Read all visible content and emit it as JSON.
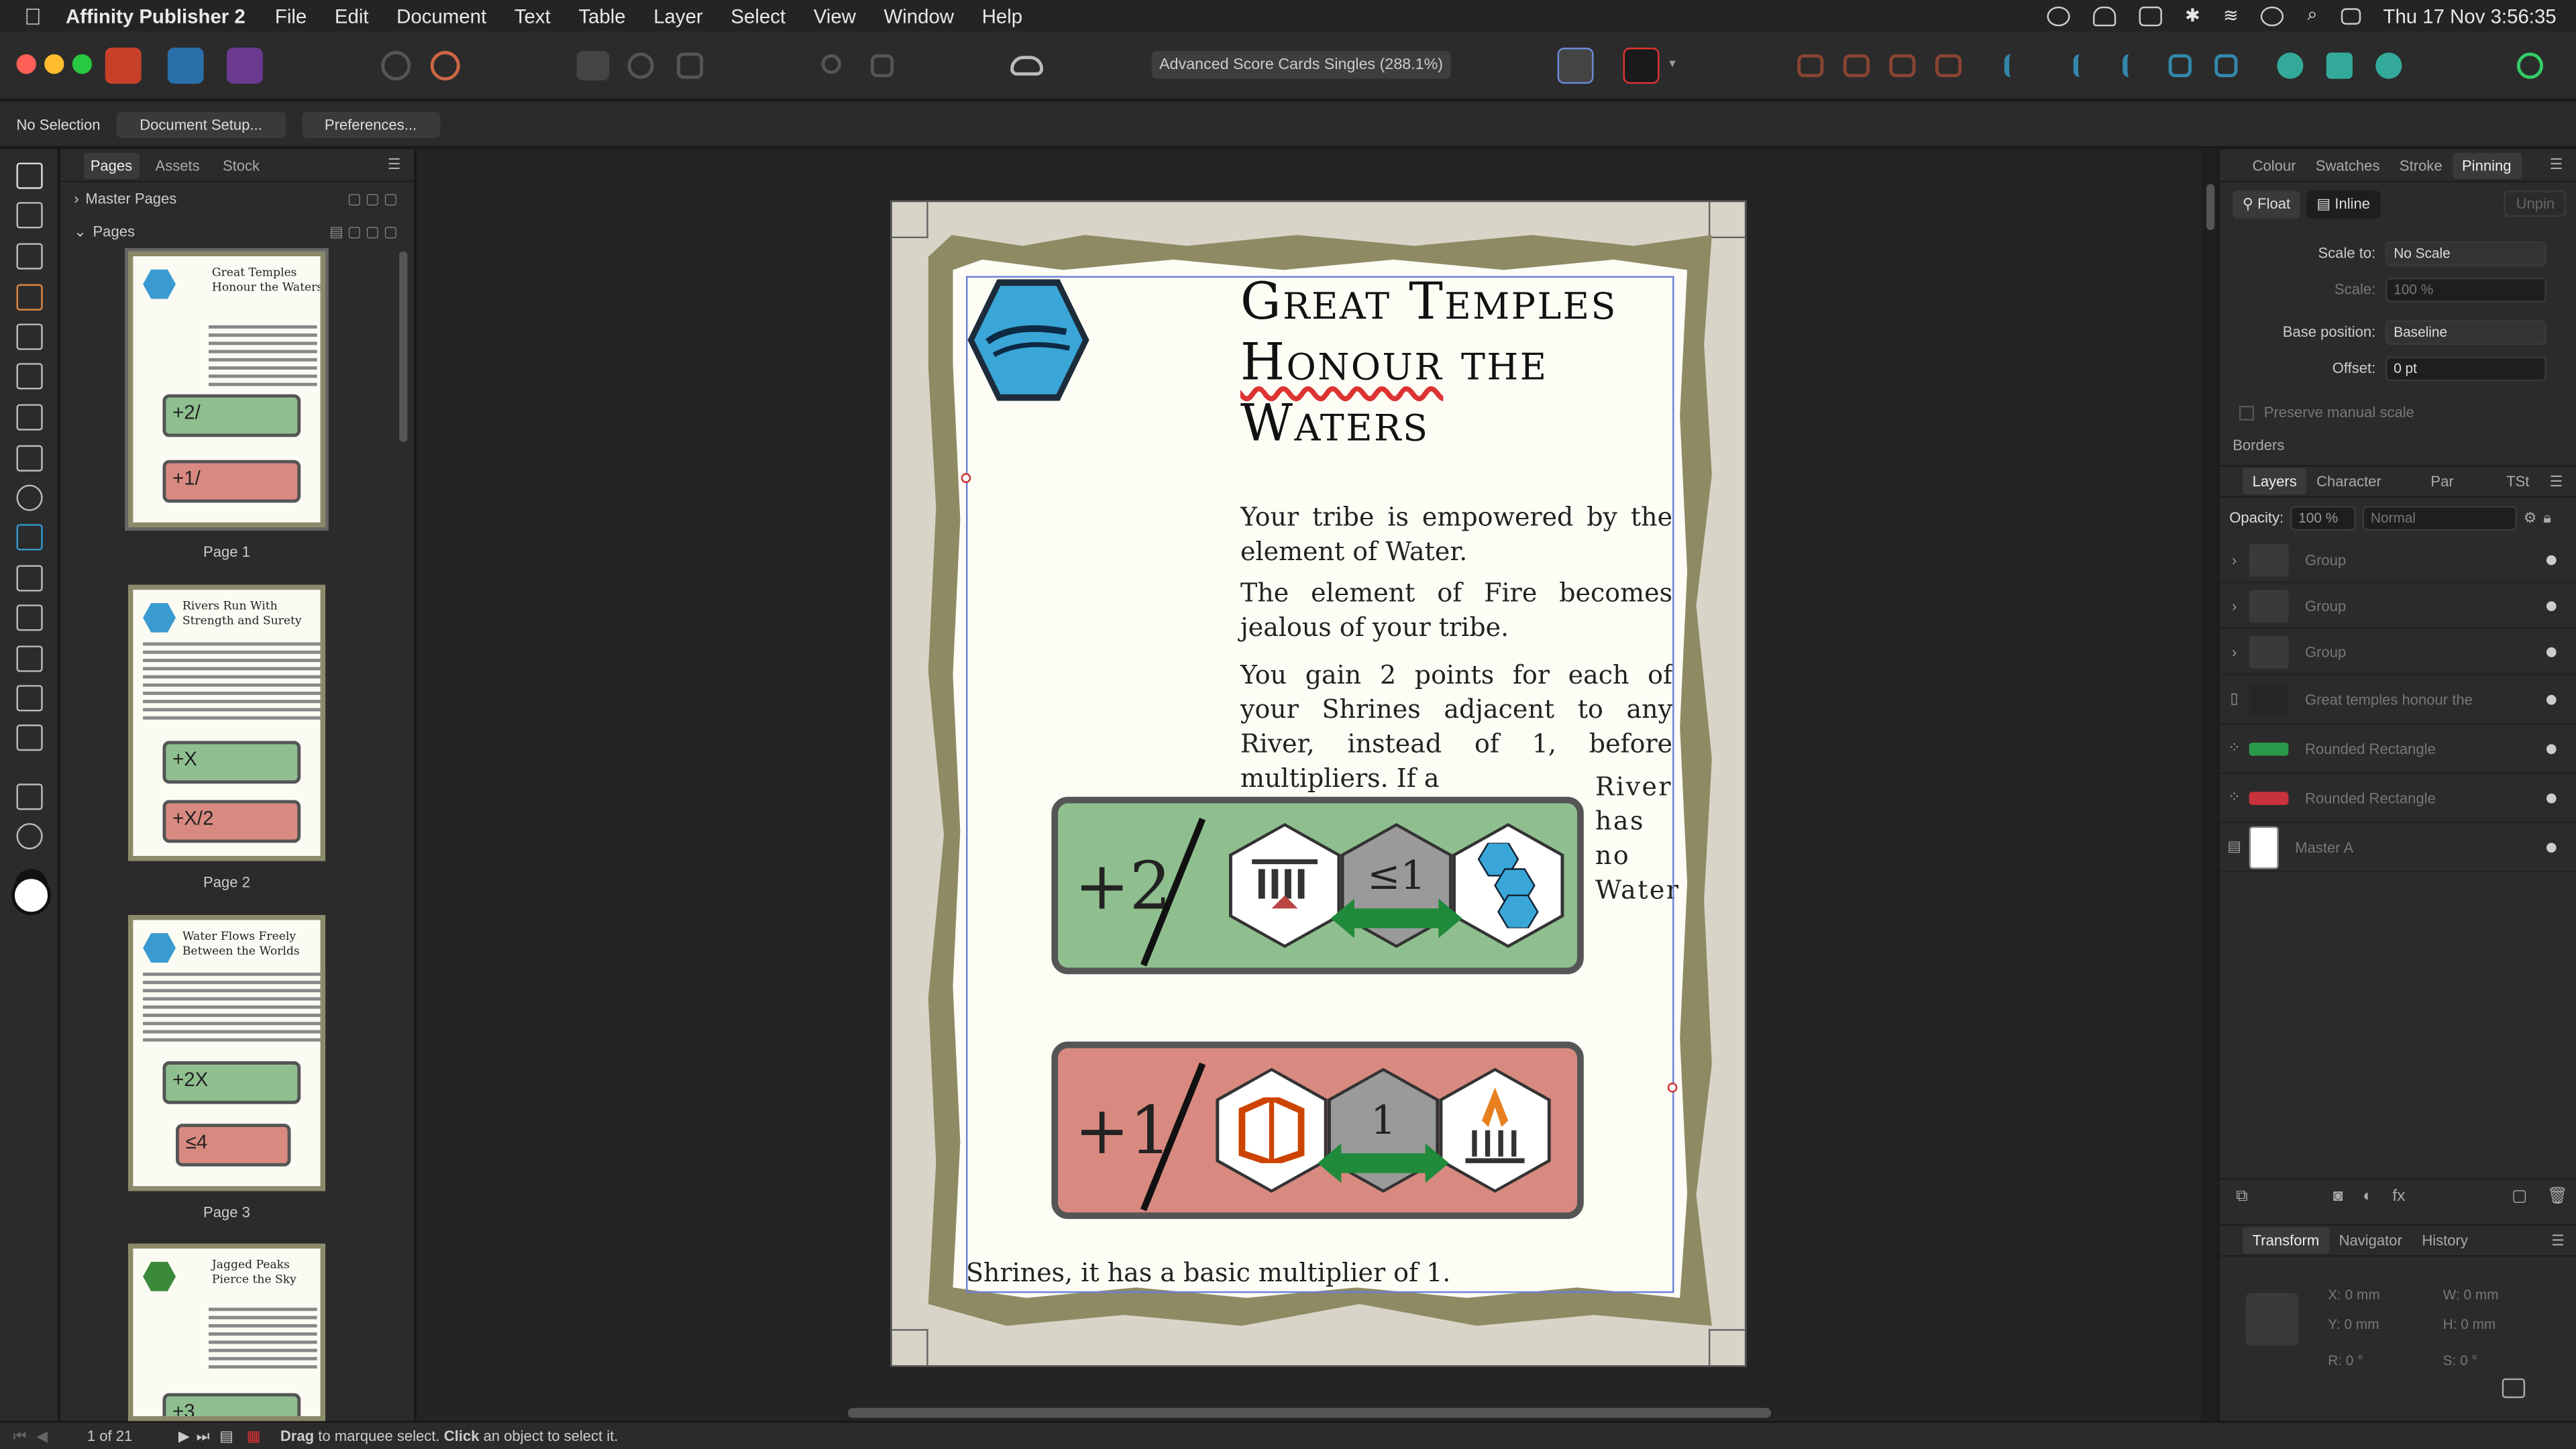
{
  "menubar": {
    "app_name": "Affinity Publisher 2",
    "items": [
      "File",
      "Edit",
      "Document",
      "Text",
      "Table",
      "Layer",
      "Select",
      "View",
      "Window",
      "Help"
    ],
    "clock": "Thu 17 Nov  3:56:35"
  },
  "toolbar": {
    "document_title": "Advanced Score Cards Singles (288.1%)"
  },
  "context_bar": {
    "selection": "No Selection",
    "document_setup": "Document Setup...",
    "preferences": "Preferences..."
  },
  "pages_panel": {
    "tabs": [
      "Pages",
      "Assets",
      "Stock"
    ],
    "master_pages": "Master Pages",
    "pages": "Pages",
    "thumbnails": [
      {
        "title": "Great Temples Honour the Waters",
        "label": "Page 1",
        "top": "+2/",
        "bottom": "+1/"
      },
      {
        "title": "Rivers Run With Strength and Surety",
        "label": "Page 2",
        "top": "+X",
        "bottom": "+X/2"
      },
      {
        "title": "Water Flows Freely Between the Worlds",
        "label": "Page 3",
        "top": "+2X",
        "bottom": "≤4"
      },
      {
        "title": "Jagged Peaks Pierce the Sky",
        "label": "",
        "top": "+3",
        "bottom": ""
      }
    ]
  },
  "page": {
    "title_line1": "Great Temples",
    "title_line2a": "Honour",
    "title_line2b": " the",
    "title_line3": "Waters",
    "p1": "Your tribe is empowered by the element of Water.",
    "p2": "The element of Fire becomes jealous of your tribe.",
    "p3": "You gain 2 points for each of your Shrines adjacent to any River, instead of 1, before multipliers. If a",
    "side": "River has no Water",
    "footer": "Shrines, it has a basic multiplier of 1.",
    "card_green": {
      "value": "+2",
      "hex_mid": "≤1"
    },
    "card_red": {
      "value": "+1",
      "hex_mid": "1"
    }
  },
  "right_panel": {
    "tabs": [
      "Colour",
      "Swatches",
      "Stroke",
      "Pinning"
    ],
    "float": "Float",
    "inline": "Inline",
    "unpin": "Unpin",
    "scale_to_label": "Scale to:",
    "scale_to": "No Scale",
    "scale_label": "Scale:",
    "scale": "100 %",
    "base_label": "Base position:",
    "base": "Baseline",
    "offset_label": "Offset:",
    "offset": "0 pt",
    "preserve": "Preserve manual scale",
    "borders": "Borders",
    "layer_tabs": [
      "Layers",
      "Character",
      "Par",
      "TSt"
    ],
    "opacity_label": "Opacity:",
    "opacity": "100 %",
    "blend": "Normal",
    "layers": [
      "Group",
      "Group",
      "Group",
      "Great temples honour the",
      "Rounded Rectangle",
      "Rounded Rectangle",
      "Master A"
    ],
    "bottom_tabs": [
      "Transform",
      "Navigator",
      "History"
    ],
    "x": "X:  0 mm",
    "y": "Y:  0 mm",
    "w": "W:  0 mm",
    "h": "H:  0 mm",
    "r": "R:  0 °",
    "s": "S:  0 °"
  },
  "status": {
    "page_count": "1 of 21",
    "hint_b1": "Drag",
    "hint_t1": " to marquee select. ",
    "hint_b2": "Click",
    "hint_t2": " an object to select it."
  },
  "colors": {
    "green_card": "#8fbf8f",
    "red_card": "#d98a80",
    "water_hex": "#3a9bd1",
    "arrow": "#1f8a3a"
  }
}
